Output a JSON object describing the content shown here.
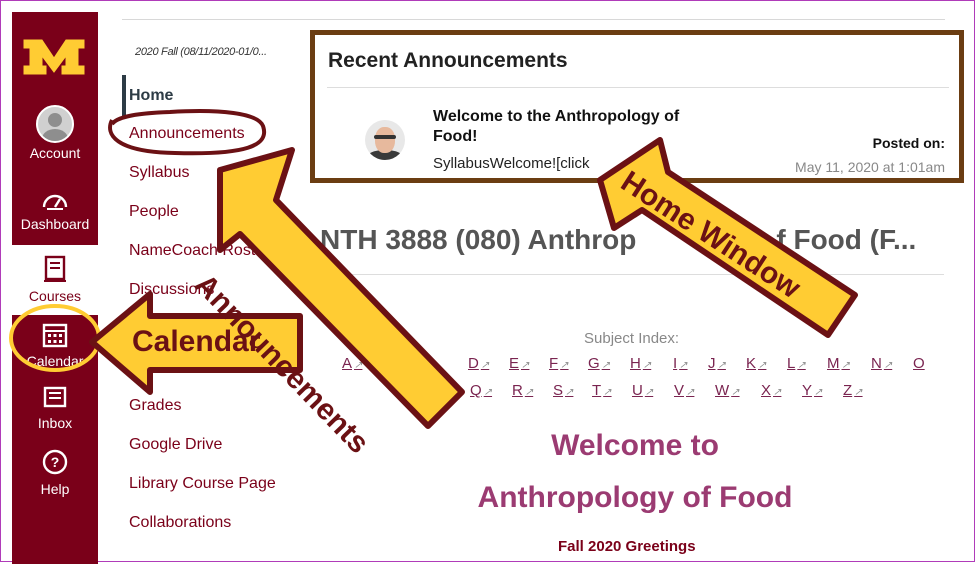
{
  "global_nav": {
    "items": [
      {
        "id": "account",
        "label": "Account",
        "icon": "avatar"
      },
      {
        "id": "dashboard",
        "label": "Dashboard",
        "icon": "speedometer-icon"
      },
      {
        "id": "courses",
        "label": "Courses",
        "icon": "book-icon"
      },
      {
        "id": "calendar",
        "label": "Calendar",
        "icon": "calendar-icon"
      },
      {
        "id": "inbox",
        "label": "Inbox",
        "icon": "inbox-icon"
      },
      {
        "id": "help",
        "label": "Help",
        "icon": "help-icon"
      }
    ],
    "logo": "M"
  },
  "course_nav": {
    "term": "2020 Fall (08/11/2020-01/0...",
    "items": [
      "Home",
      "Announcements",
      "Syllabus",
      "People",
      "NameCoach Roster",
      "Discussions",
      "Grades",
      "Google Drive",
      "Library Course Page",
      "Collaborations"
    ]
  },
  "announcements": {
    "title": "Recent Announcements",
    "item_title": "Welcome to the Anthropology of Food!",
    "item_body": "SyllabusWelcome![click",
    "posted_label": "Posted on:",
    "posted_date": "May 11, 2020 at 1:01am"
  },
  "course": {
    "title_visible": "NTH 3888 (080) Anthrop",
    "title_tail": "f Food (F...",
    "subject_index": "Subject Index:",
    "letters_row1": [
      "A",
      "D",
      "E",
      "F",
      "G",
      "H",
      "I",
      "J",
      "K",
      "L",
      "M",
      "N",
      "O"
    ],
    "letters_row2": [
      "Q",
      "R",
      "S",
      "T",
      "U",
      "V",
      "W",
      "X",
      "Y",
      "Z"
    ],
    "welcome_line1": "Welcome to",
    "welcome_line2": "Anthropology of Food",
    "greeting": "Fall 2020 Greetings"
  },
  "callouts": {
    "announcements": "Announcements",
    "home_window": "Home Window",
    "calendar": "Calendar"
  },
  "colors": {
    "maroon": "#7a0019",
    "gold": "#ffcc33",
    "arrow_outline": "#6b1114"
  }
}
